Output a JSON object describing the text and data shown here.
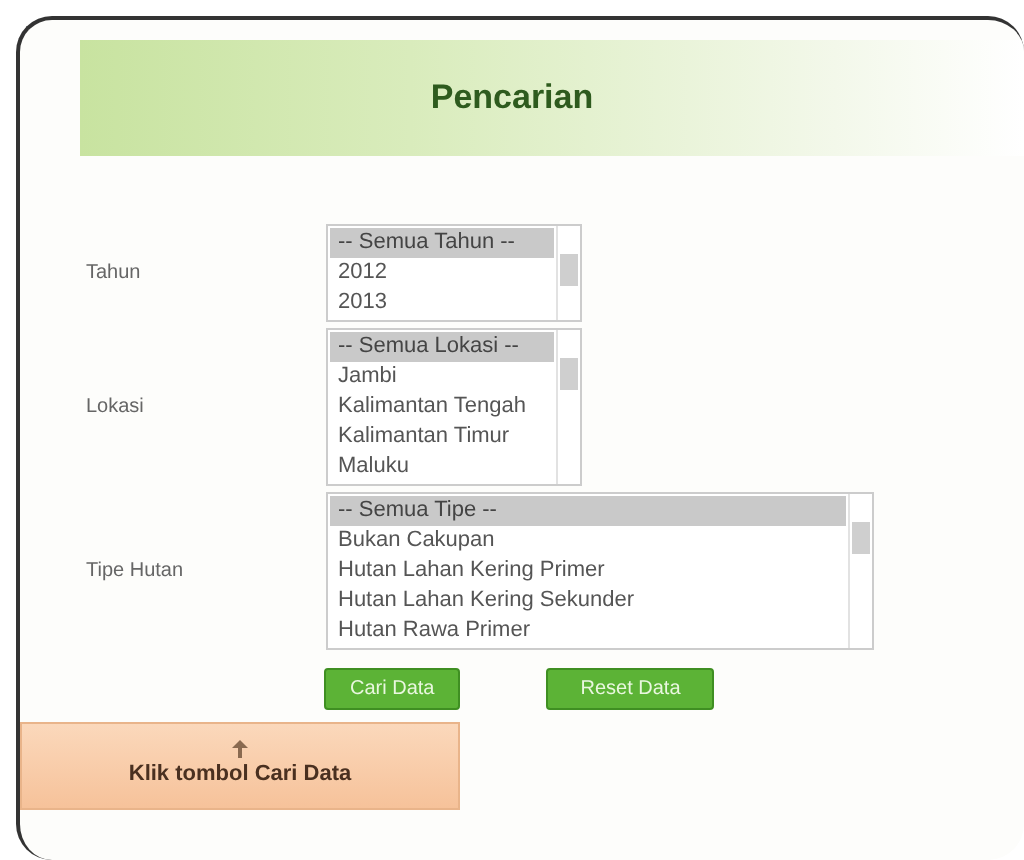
{
  "title": "Pencarian",
  "fields": [
    {
      "label": "Tahun",
      "wide": false,
      "options": [
        {
          "text": "-- Semua Tahun --",
          "selected": true
        },
        {
          "text": "2012",
          "selected": false
        },
        {
          "text": "2013",
          "selected": false
        }
      ]
    },
    {
      "label": "Lokasi",
      "wide": false,
      "options": [
        {
          "text": "-- Semua Lokasi --",
          "selected": true
        },
        {
          "text": "Jambi",
          "selected": false
        },
        {
          "text": "Kalimantan Tengah",
          "selected": false
        },
        {
          "text": "Kalimantan Timur",
          "selected": false
        },
        {
          "text": "Maluku",
          "selected": false
        }
      ]
    },
    {
      "label": "Tipe Hutan",
      "wide": true,
      "options": [
        {
          "text": "-- Semua Tipe --",
          "selected": true
        },
        {
          "text": "Bukan Cakupan",
          "selected": false
        },
        {
          "text": "Hutan Lahan Kering Primer",
          "selected": false
        },
        {
          "text": "Hutan Lahan Kering Sekunder",
          "selected": false
        },
        {
          "text": "Hutan Rawa Primer",
          "selected": false
        }
      ]
    }
  ],
  "buttons": [
    "Cari Data",
    "Reset Data"
  ],
  "callout": "Klik tombol Cari Data"
}
